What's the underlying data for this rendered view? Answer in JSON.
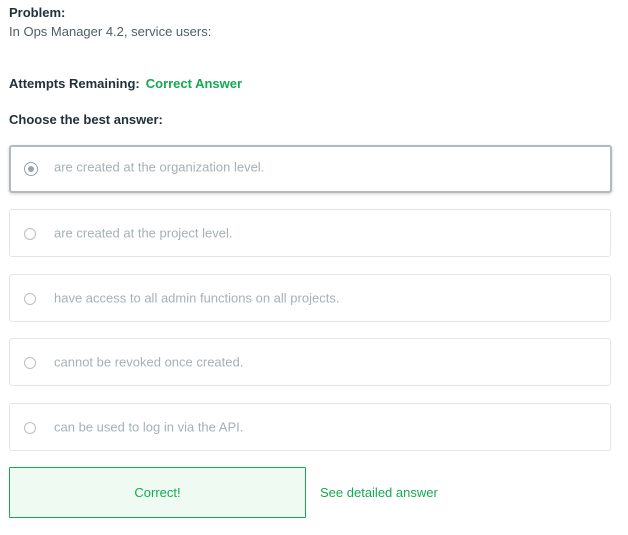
{
  "problem": {
    "label": "Problem:",
    "text": "In Ops Manager 4.2, service users:"
  },
  "attempts": {
    "label": "Attempts Remaining:",
    "status": "Correct Answer"
  },
  "choose_label": "Choose the best answer:",
  "options": [
    {
      "label": "are created at the organization level.",
      "selected": true
    },
    {
      "label": "are created at the project level.",
      "selected": false
    },
    {
      "label": "have access to all admin functions on all projects.",
      "selected": false
    },
    {
      "label": "cannot be revoked once created.",
      "selected": false
    },
    {
      "label": "can be used to log in via the API.",
      "selected": false
    }
  ],
  "result": {
    "message": "Correct!",
    "detail_link": "See detailed answer"
  },
  "colors": {
    "accent_green": "#13aa52",
    "result_bg": "#effaf3",
    "heading": "#21313c",
    "muted_text": "#a7b0b5"
  }
}
